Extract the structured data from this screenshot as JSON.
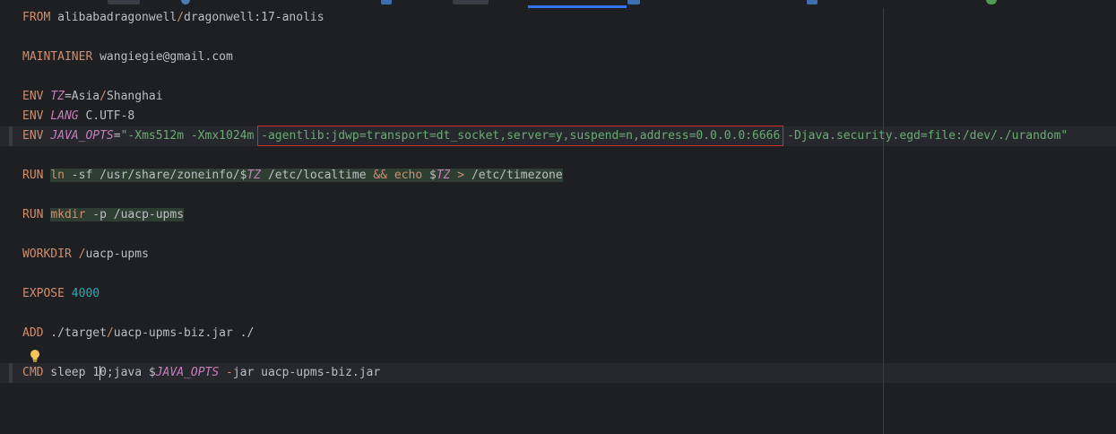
{
  "editor": {
    "lines": [
      {
        "tokens": [
          {
            "k": "kw",
            "t": "FROM"
          },
          {
            "k": "pl",
            "t": " alibabadragonwell"
          },
          {
            "k": "op",
            "t": "/"
          },
          {
            "k": "pl",
            "t": "dragonwell:17-anolis"
          }
        ]
      },
      {
        "tokens": []
      },
      {
        "tokens": [
          {
            "k": "kw",
            "t": "MAINTAINER"
          },
          {
            "k": "pl",
            "t": " wangiegie@gmail.com"
          }
        ]
      },
      {
        "tokens": []
      },
      {
        "tokens": [
          {
            "k": "kw",
            "t": "ENV"
          },
          {
            "k": "pl",
            "t": " "
          },
          {
            "k": "var",
            "t": "TZ"
          },
          {
            "k": "pl",
            "t": "=Asia"
          },
          {
            "k": "op",
            "t": "/"
          },
          {
            "k": "pl",
            "t": "Shanghai"
          }
        ]
      },
      {
        "tokens": [
          {
            "k": "kw",
            "t": "ENV"
          },
          {
            "k": "pl",
            "t": " "
          },
          {
            "k": "var",
            "t": "LANG"
          },
          {
            "k": "pl",
            "t": " C.UTF-8"
          }
        ]
      },
      {
        "tokens": [
          {
            "k": "kw",
            "t": "ENV"
          },
          {
            "k": "pl",
            "t": " "
          },
          {
            "k": "var",
            "t": "JAVA_OPTS"
          },
          {
            "k": "pl",
            "t": "="
          },
          {
            "k": "str",
            "t": "\"-Xms512m -Xmx1024m "
          },
          {
            "k": "str box",
            "t": "-agentlib:jdwp=transport=dt_socket,server=y,suspend=n,address=0.0.0.0:6666"
          },
          {
            "k": "str",
            "t": " -Djava.security.egd=file:/dev/./urandom\""
          }
        ]
      },
      {
        "tokens": []
      },
      {
        "tokens": [
          {
            "k": "kw",
            "t": "RUN"
          },
          {
            "k": "pl",
            "t": " "
          },
          {
            "k": "kw hl",
            "t": "ln"
          },
          {
            "k": "pl hl",
            "t": " -sf /usr/share/zoneinfo/$"
          },
          {
            "k": "var hl",
            "t": "TZ"
          },
          {
            "k": "pl hl",
            "t": " /etc/localtime "
          },
          {
            "k": "kw hl",
            "t": "&&"
          },
          {
            "k": "pl hl",
            "t": " "
          },
          {
            "k": "kw hl",
            "t": "echo"
          },
          {
            "k": "pl hl",
            "t": " $"
          },
          {
            "k": "var hl",
            "t": "TZ"
          },
          {
            "k": "pl hl",
            "t": " "
          },
          {
            "k": "op hl",
            "t": ">"
          },
          {
            "k": "pl hl",
            "t": " /etc/timezone"
          }
        ]
      },
      {
        "tokens": []
      },
      {
        "tokens": [
          {
            "k": "kw",
            "t": "RUN"
          },
          {
            "k": "pl",
            "t": " "
          },
          {
            "k": "kw hl",
            "t": "mkdir"
          },
          {
            "k": "pl hl",
            "t": " -p /uacp-upms"
          }
        ]
      },
      {
        "tokens": []
      },
      {
        "tokens": [
          {
            "k": "kw",
            "t": "WORKDIR"
          },
          {
            "k": "pl",
            "t": " "
          },
          {
            "k": "op",
            "t": "/"
          },
          {
            "k": "pl",
            "t": "uacp-upms"
          }
        ]
      },
      {
        "tokens": []
      },
      {
        "tokens": [
          {
            "k": "kw",
            "t": "EXPOSE"
          },
          {
            "k": "pl",
            "t": " "
          },
          {
            "k": "num",
            "t": "4000"
          }
        ]
      },
      {
        "tokens": []
      },
      {
        "tokens": [
          {
            "k": "kw",
            "t": "ADD"
          },
          {
            "k": "pl",
            "t": " ./target"
          },
          {
            "k": "op",
            "t": "/"
          },
          {
            "k": "pl",
            "t": "uacp-upms-biz.jar ./"
          }
        ]
      },
      {
        "tokens": []
      },
      {
        "tokens": [
          {
            "k": "kw",
            "t": "CMD"
          },
          {
            "k": "pl",
            "t": " sleep 1"
          },
          {
            "k": "caret",
            "t": ""
          },
          {
            "k": "pl",
            "t": "0;java $"
          },
          {
            "k": "var",
            "t": "JAVA_OPTS"
          },
          {
            "k": "pl",
            "t": " "
          },
          {
            "k": "op",
            "t": "-"
          },
          {
            "k": "pl",
            "t": "jar uacp-upms-biz.jar"
          }
        ]
      }
    ]
  }
}
